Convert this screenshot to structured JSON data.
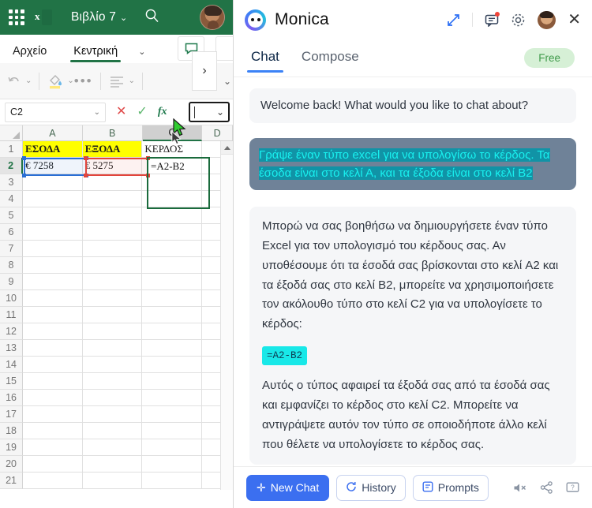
{
  "excel": {
    "titlebar": {
      "app_icon": "excel-logo-icon",
      "waffle_icon": "app-launcher-icon",
      "document_title": "Βιβλίο 7",
      "title_chevron": "⌄",
      "search_icon": "search-icon",
      "avatar": "user-avatar"
    },
    "ribbon": {
      "tabs": [
        {
          "label": "Αρχείο",
          "active": false
        },
        {
          "label": "Κεντρική",
          "active": true
        }
      ],
      "tabs_chevron": "⌄",
      "comment_icon": "comment-icon",
      "tools": {
        "undo_icon": "undo-icon",
        "fill_color_icon": "fill-color-icon",
        "more_icon": "more-options-icon",
        "align_icon": "align-left-icon",
        "overflow_label": "›",
        "overflow_caret": "⌄"
      }
    },
    "formula_bar": {
      "name_box_value": "C2",
      "name_box_chevron": "⌄",
      "cancel_icon": "cancel-icon",
      "enter_icon": "enter-icon",
      "function_icon": "insert-function-icon",
      "formula_value": "",
      "formula_chevron": "⌄"
    },
    "grid": {
      "select_all_icon": "select-all-icon",
      "columns": [
        "A",
        "B",
        "C",
        "D"
      ],
      "selected_column": "C",
      "rows": [
        "1",
        "2",
        "3",
        "4",
        "5",
        "6",
        "7",
        "8",
        "9",
        "10",
        "11",
        "12",
        "13",
        "14",
        "15",
        "16",
        "17",
        "18",
        "19",
        "20",
        "21"
      ],
      "selected_row": "2",
      "cells": {
        "A1": "ΕΣΟΔΑ",
        "B1": "ΕΞΟΔΑ",
        "C1": "ΚΕΡΔΟΣ",
        "A2": "€ 7258",
        "B2": "€ 5275",
        "C2": "=A2-B2"
      },
      "highlight_color": "#ffff00",
      "ref_a_color": "#2a6fd4",
      "ref_b_color": "#e2453c",
      "active_cell_color": "#1a6b3c",
      "scroll_up_icon": "scroll-up-icon"
    }
  },
  "monica": {
    "header": {
      "logo_icon": "monica-logo-icon",
      "title": "Monica",
      "expand_icon": "expand-icon",
      "messages_icon": "messages-icon",
      "settings_icon": "gear-icon",
      "avatar_icon": "user-avatar",
      "close_icon": "close-icon"
    },
    "tabs": [
      {
        "label": "Chat",
        "active": true
      },
      {
        "label": "Compose",
        "active": false
      }
    ],
    "plan_badge": "Free",
    "messages": [
      {
        "role": "system",
        "text": "Welcome back! What would you like to chat about?"
      },
      {
        "role": "user",
        "text": "Γράψε έναν τύπο excel για να υπολογίσω το κέρδος. Τα έσοδα είναι στο κελί Α, και τα έξοδα είναι στο κελί Β2"
      },
      {
        "role": "assistant",
        "paragraph_1": "Μπορώ να σας βοηθήσω να δημιουργήσετε έναν τύπο Excel για τον υπολογισμό του κέρδους σας. Αν υποθέσουμε ότι τα έσοδά σας βρίσκονται στο κελί A2 και τα έξοδά σας στο κελί B2, μπορείτε να χρησιμοποιήσετε τον ακόλουθο τύπο στο κελί C2 για να υπολογίσετε το κέρδος:",
        "code": "=A2-B2",
        "paragraph_2": "Αυτός ο τύπος αφαιρεί τα έξοδά σας από τα έσοδά σας και εμφανίζει το κέρδος στο κελί C2. Μπορείτε να αντιγράψετε αυτόν τον τύπο σε οποιοδήποτε άλλο κελί που θέλετε να υπολογίσετε το κέρδος σας."
      }
    ],
    "book_button_icon": "📖",
    "footer": {
      "new_chat_label": "New Chat",
      "new_chat_icon": "plus-icon",
      "history_label": "History",
      "history_icon": "history-icon",
      "prompts_label": "Prompts",
      "prompts_icon": "prompts-icon",
      "mute_icon": "mute-icon",
      "share_icon": "share-icon",
      "feedback_icon": "feedback-icon"
    }
  }
}
